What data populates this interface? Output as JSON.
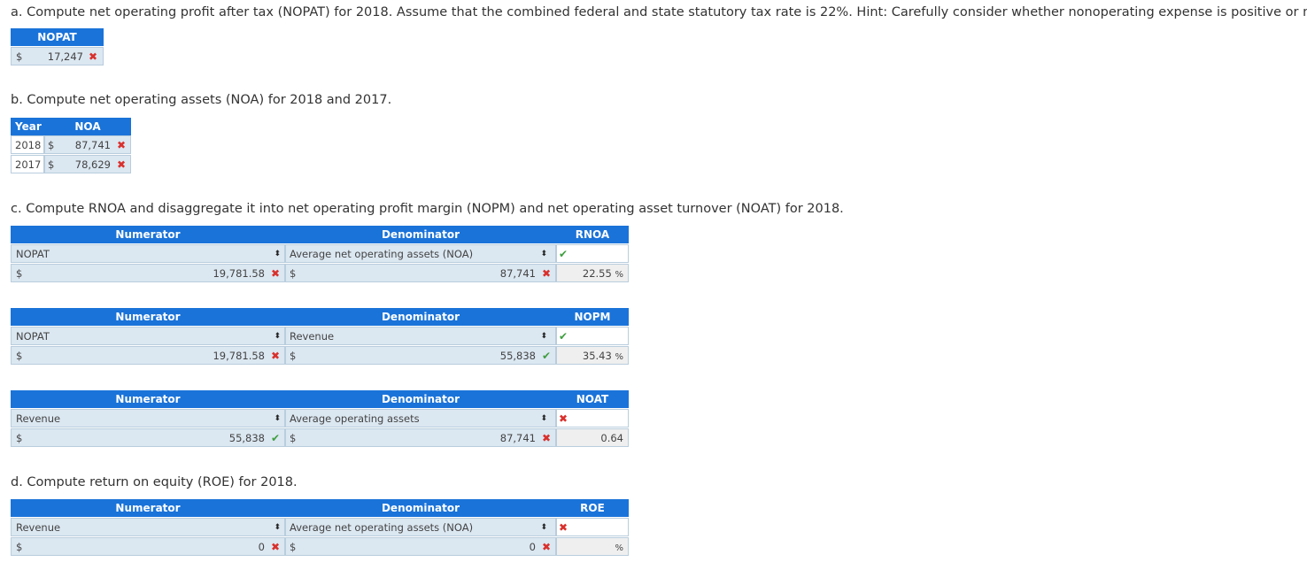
{
  "part_a": {
    "question": "a. Compute net operating profit after tax (NOPAT) for 2018. Assume that the combined federal and state statutory tax rate is 22%. Hint: Carefully consider whether nonoperating expense is positive or negative.",
    "header": "NOPAT",
    "currency": "$",
    "value": "17,247"
  },
  "part_b": {
    "question": "b. Compute net operating assets (NOA) for 2018 and 2017.",
    "col_year": "Year",
    "col_noa": "NOA",
    "rows": [
      {
        "year": "2018",
        "currency": "$",
        "value": "87,741"
      },
      {
        "year": "2017",
        "currency": "$",
        "value": "78,629"
      }
    ]
  },
  "part_c": {
    "question": "c. Compute RNOA and disaggregate it into net operating profit margin (NOPM) and net operating asset turnover (NOAT) for 2018.",
    "tables": [
      {
        "numerator_header": "Numerator",
        "denominator_header": "Denominator",
        "result_header": "RNOA",
        "num_select": "NOPAT",
        "den_select": "Average net operating assets (NOA)",
        "num_currency": "$",
        "num_value": "19,781.58",
        "num_status": "x",
        "den_currency": "$",
        "den_value": "87,741",
        "den_status": "x",
        "select_status": "check",
        "result_value": "22.55",
        "result_unit": "%"
      },
      {
        "numerator_header": "Numerator",
        "denominator_header": "Denominator",
        "result_header": "NOPM",
        "num_select": "NOPAT",
        "den_select": "Revenue",
        "num_currency": "$",
        "num_value": "19,781.58",
        "num_status": "x",
        "den_currency": "$",
        "den_value": "55,838",
        "den_status": "check",
        "select_status": "check",
        "result_value": "35.43",
        "result_unit": "%"
      },
      {
        "numerator_header": "Numerator",
        "denominator_header": "Denominator",
        "result_header": "NOAT",
        "num_select": "Revenue",
        "den_select": "Average operating assets",
        "num_currency": "$",
        "num_value": "55,838",
        "num_status": "check",
        "den_currency": "$",
        "den_value": "87,741",
        "den_status": "x",
        "select_status": "x",
        "result_value": "0.64",
        "result_unit": ""
      }
    ]
  },
  "part_d": {
    "question": "d. Compute return on equity (ROE) for 2018.",
    "table": {
      "numerator_header": "Numerator",
      "denominator_header": "Denominator",
      "result_header": "ROE",
      "num_select": "Revenue",
      "den_select": "Average net operating assets (NOA)",
      "num_currency": "$",
      "num_value": "0",
      "num_status": "x",
      "den_currency": "$",
      "den_value": "0",
      "den_status": "x",
      "select_status": "x",
      "result_value": "",
      "result_unit": "%"
    }
  },
  "colors": {
    "header_blue": "#1a73d9",
    "cell_blue": "#dbe7f1",
    "incorrect_red": "#d9302c",
    "correct_green": "#3f9e3f"
  },
  "icons": {
    "incorrect": "✖",
    "correct": "✔",
    "select_arrows": "⬍"
  }
}
